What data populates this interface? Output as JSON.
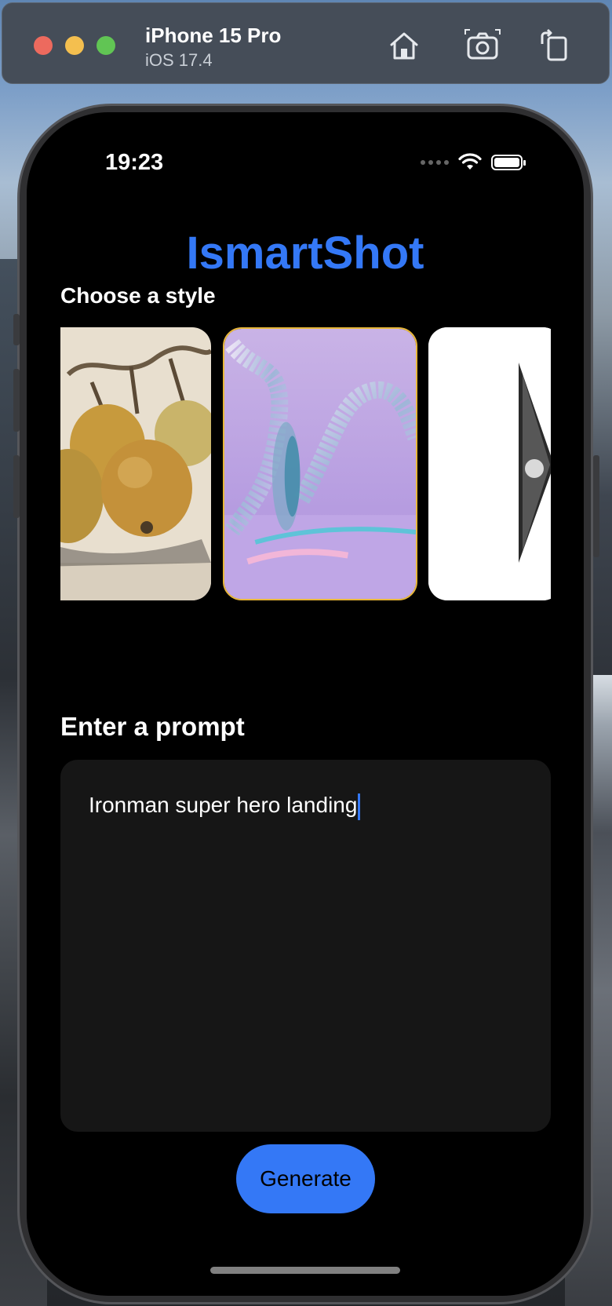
{
  "simulator": {
    "device_name": "iPhone 15 Pro",
    "os_version": "iOS 17.4",
    "toolbar_icons": [
      "home-icon",
      "screenshot-icon",
      "rotate-icon"
    ]
  },
  "status_bar": {
    "time": "19:23",
    "icons": [
      "cellular-dots-icon",
      "wifi-icon",
      "battery-icon"
    ]
  },
  "app": {
    "title": "IsmartShot",
    "style_section_label": "Choose a style",
    "styles": [
      {
        "name": "vintage-fruit-painting",
        "selected": false
      },
      {
        "name": "iridescent-glass-abstract",
        "selected": true
      },
      {
        "name": "white-minimal",
        "selected": false
      }
    ],
    "prompt_section_label": "Enter a prompt",
    "prompt_value": "Ironman super hero landing",
    "generate_label": "Generate"
  },
  "colors": {
    "accent": "#3478f6",
    "selected_border": "#e8b73a",
    "screen_bg": "#000000",
    "input_bg": "#161616"
  }
}
